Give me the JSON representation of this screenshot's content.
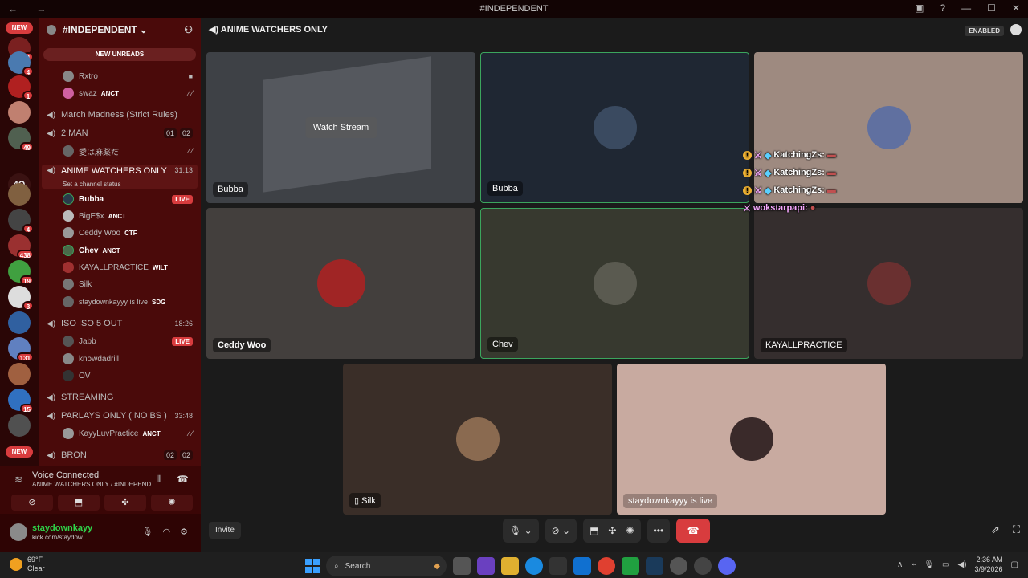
{
  "window": {
    "title": "#INDEPENDENT",
    "nav": "← →"
  },
  "servers": {
    "new_top": "NEW",
    "new_bottom": "NEW",
    "fourq": "4Q",
    "badges": [
      "4",
      "4",
      "1",
      "49",
      "4",
      "438",
      "19",
      "3",
      "131",
      "15"
    ]
  },
  "sidebar": {
    "guild_name": "#INDEPENDENT",
    "new_unreads": "NEW UNREADS",
    "users_top": [
      {
        "name": "Rxtro"
      },
      {
        "name": "swaz",
        "tag": "ANCT"
      }
    ],
    "channels": {
      "march": {
        "name": "March Madness (Strict Rules)"
      },
      "two_man": {
        "name": "2 MAN",
        "c1": "01",
        "c2": "02"
      },
      "two_man_user": "愛は麻薬だ",
      "anime": {
        "name": "ANIME WATCHERS ONLY",
        "time": "31:13",
        "status": "Set a channel status"
      },
      "iso": {
        "name": "ISO ISO 5 OUT",
        "time": "18:26"
      },
      "streaming": {
        "name": "STREAMING"
      },
      "parlays": {
        "name": "PARLAYS ONLY ( NO BS )",
        "time": "33:48"
      },
      "bron": {
        "name": "BRON",
        "c1": "02",
        "c2": "02"
      }
    },
    "anime_users": [
      {
        "name": "Bubba",
        "live": "LIVE"
      },
      {
        "name": "BigE$x",
        "tag": "ANCT"
      },
      {
        "name": "Ceddy Woo",
        "tag": "CTF"
      },
      {
        "name": "Chev",
        "tag": "ANCT"
      },
      {
        "name": "KAYALLPRACTICE",
        "tag": "WILT"
      },
      {
        "name": "Silk"
      },
      {
        "name": "staydownkayyy is live",
        "tag": "SDG"
      }
    ],
    "iso_users": [
      {
        "name": "Jabb",
        "live": "LIVE"
      },
      {
        "name": "knowdadrill"
      },
      {
        "name": "OV"
      }
    ],
    "parlay_user": {
      "name": "KayyLuvPractice",
      "tag": "ANCT"
    }
  },
  "voice": {
    "title": "Voice Connected",
    "subtitle": "ANIME WATCHERS ONLY / #INDEPEND..."
  },
  "user": {
    "name": "staydownkayy",
    "status": "kick.com/staydow"
  },
  "main": {
    "channel": "ANIME WATCHERS ONLY",
    "enabled": "ENABLED",
    "watch_stream": "Watch Stream",
    "tiles": {
      "t1": "Bubba",
      "t2": "Bubba",
      "t4": "Ceddy Woo",
      "t5": "Chev",
      "t6": "KAYALLPRACTICE",
      "t7": "Silk",
      "t8": "staydownkayyy is live"
    },
    "chat": [
      {
        "user": "KatchingZs:"
      },
      {
        "user": "KatchingZs:"
      },
      {
        "user": "KatchingZs:"
      },
      {
        "user": "wokstarpapi:"
      }
    ],
    "invite": "Invite"
  },
  "taskbar": {
    "temp": "69°F",
    "cond": "Clear",
    "search": "Search",
    "time": "2:36 AM",
    "date": "3/9/2026"
  },
  "colors": {
    "server_bar": "#2a0606",
    "sidebar": "#4a0a0a",
    "accent_red": "#d83c3e",
    "speaking": "#3ba55d"
  }
}
